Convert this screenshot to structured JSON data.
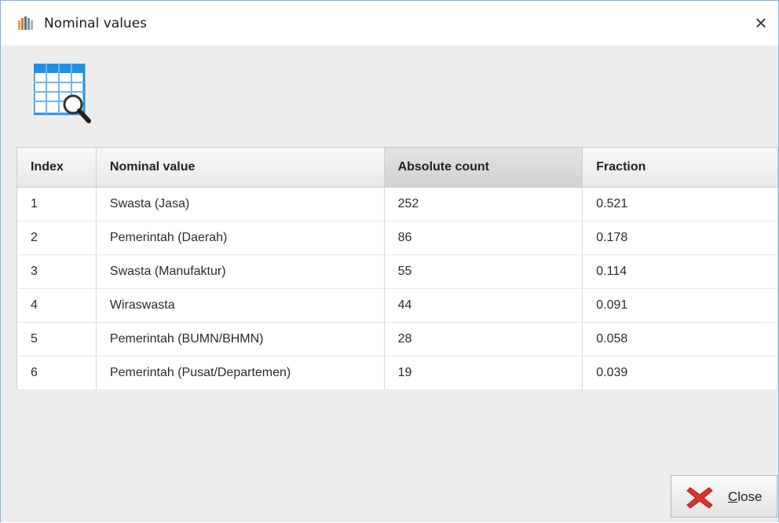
{
  "window": {
    "title": "Nominal values"
  },
  "table": {
    "headers": [
      "Index",
      "Nominal value",
      "Absolute count",
      "Fraction"
    ],
    "rows": [
      [
        "1",
        "Swasta (Jasa)",
        "252",
        "0.521"
      ],
      [
        "2",
        "Pemerintah (Daerah)",
        "86",
        "0.178"
      ],
      [
        "3",
        "Swasta (Manufaktur)",
        "55",
        "0.114"
      ],
      [
        "4",
        "Wiraswasta",
        "44",
        "0.091"
      ],
      [
        "5",
        "Pemerintah (BUMN/BHMN)",
        "28",
        "0.058"
      ],
      [
        "6",
        "Pemerintah (Pusat/Departemen)",
        "19",
        "0.039"
      ]
    ],
    "sorted_column": "Absolute count"
  },
  "buttons": {
    "close_label": "Close"
  },
  "icons": {
    "app": "app-logo-icon",
    "title_close": "close-icon",
    "header": "table-search-icon",
    "close_button": "red-x-icon"
  },
  "colors": {
    "accent_blue": "#1e90e6",
    "close_red": "#d9352b"
  }
}
